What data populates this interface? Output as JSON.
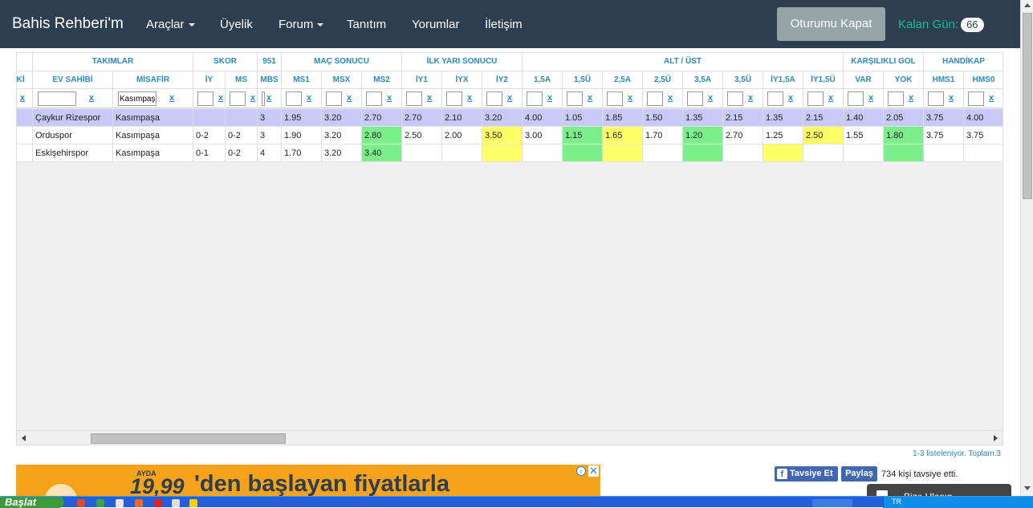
{
  "navbar": {
    "brand": "Bahis Rehberi'm",
    "items": [
      {
        "label": "Araçlar",
        "dropdown": true
      },
      {
        "label": "Üyelik",
        "dropdown": false
      },
      {
        "label": "Forum",
        "dropdown": true
      },
      {
        "label": "Tanıtım",
        "dropdown": false
      },
      {
        "label": "Yorumlar",
        "dropdown": false
      },
      {
        "label": "İletişim",
        "dropdown": false
      }
    ],
    "logout_label": "Oturumu Kapat",
    "days_left_label": "Kalan Gün:",
    "days_left_value": "66"
  },
  "grid": {
    "group_headers": [
      "TAKIMLAR",
      "SKOR",
      "951",
      "MAÇ SONUCU",
      "İLK YARI SONUCU",
      "ALT / ÜST",
      "KARŞILIKLI GOL",
      "HANDİKAP"
    ],
    "columns": [
      "Ç Kİ",
      "EV SAHİBİ",
      "MİSAFİR",
      "İY",
      "MS",
      "MBS",
      "MS1",
      "MSX",
      "MS2",
      "İY1",
      "İYX",
      "İY2",
      "1,5A",
      "1,5Ü",
      "2,5A",
      "2,5Ü",
      "3,5A",
      "3,5Ü",
      "İY1,5A",
      "İY1,5Ü",
      "VAR",
      "YOK",
      "HMS1",
      "HMS0"
    ],
    "filter_link": "x",
    "filter_misafir_value": "Kasımpaşa",
    "rows": [
      {
        "highlight": "selected",
        "cells": [
          "",
          "Çaykur Rizespor",
          "Kasımpaşa",
          "",
          "",
          "3",
          "1.95",
          "3.20",
          "2.70",
          "2.70",
          "2.10",
          "3.20",
          "4.00",
          "1.05",
          "1.85",
          "1.50",
          "1.35",
          "2.15",
          "1.35",
          "2.15",
          "1.40",
          "2.05",
          "3.75",
          "4.00"
        ]
      },
      {
        "highlight": "none",
        "cells": [
          "",
          "Orduspor",
          "Kasımpaşa",
          "0-2",
          "0-2",
          "3",
          "1.90",
          "3.20",
          "2.80",
          "2.50",
          "2.00",
          "3.50",
          "3.00",
          "1.15",
          "1.65",
          "1.70",
          "1.20",
          "2.70",
          "1.25",
          "2.50",
          "1.55",
          "1.80",
          "3.75",
          "3.75"
        ]
      },
      {
        "highlight": "none",
        "cells": [
          "",
          "Eskişehirspor",
          "Kasımpaşa",
          "0-1",
          "0-2",
          "4",
          "1.70",
          "3.20",
          "3.40",
          "",
          "",
          "",
          "",
          "",
          "",
          "",
          "",
          "",
          "",
          "",
          "",
          "",
          "",
          ""
        ]
      }
    ],
    "cell_colors": {
      "green": [
        [
          1,
          8
        ],
        [
          1,
          13
        ],
        [
          1,
          16
        ],
        [
          1,
          21
        ],
        [
          2,
          8
        ],
        [
          2,
          13
        ],
        [
          2,
          16
        ],
        [
          2,
          21
        ]
      ],
      "yellow": [
        [
          1,
          11
        ],
        [
          1,
          14
        ],
        [
          1,
          19
        ],
        [
          2,
          11
        ],
        [
          2,
          14
        ],
        [
          2,
          18
        ]
      ]
    },
    "footer": "1-3 listeleniyor. Toplam:3"
  },
  "ad": {
    "badge": "AYDA",
    "price": "19,99",
    "text": "'den başlayan fiyatlarla"
  },
  "social": {
    "recommend_label": "Tavsiye Et",
    "share_label": "Paylaş",
    "count_text": "734 kişi tavsiye etti."
  },
  "contact": {
    "label": "Bize Ulaşın"
  },
  "taskbar": {
    "start_label": "Başlat",
    "language": "TR"
  },
  "colors": {
    "navbar": "#2c3e50",
    "accent": "#18bc9c",
    "link": "#2a88c5",
    "selected_row": "#c9c9f8",
    "green_cell": "#7bf08a",
    "yellow_cell": "#ffff66",
    "ad_bg": "#f5a31b",
    "facebook": "#4267b2"
  }
}
